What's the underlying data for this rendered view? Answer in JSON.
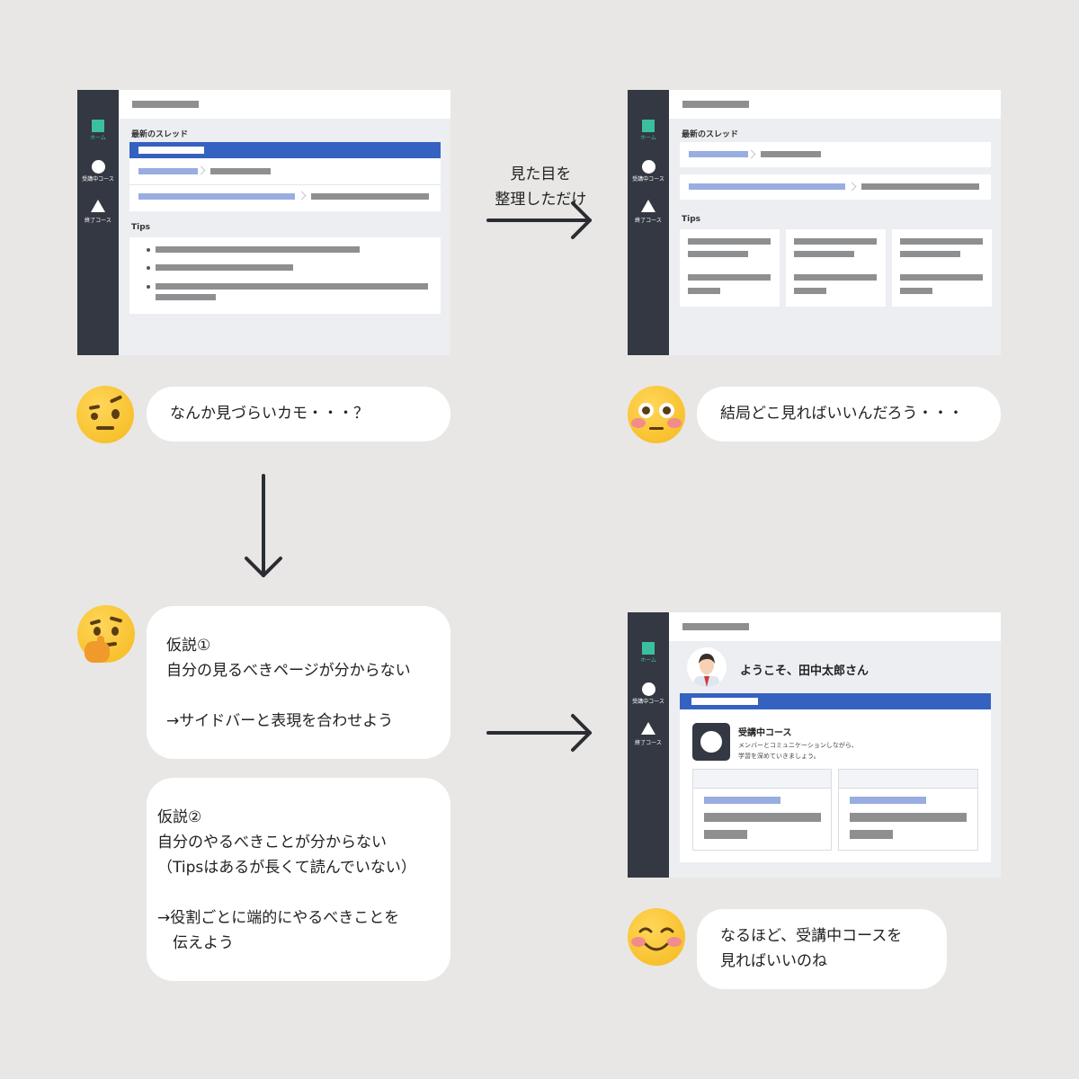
{
  "mock1": {
    "thread_label": "最新のスレッド",
    "tips_label": "Tips",
    "nav": {
      "home": "ホーム",
      "enrolled": "受講中コース",
      "finished": "終了コース"
    }
  },
  "mock2": {
    "thread_label": "最新のスレッド",
    "tips_label": "Tips",
    "nav": {
      "home": "ホーム",
      "enrolled": "受講中コース",
      "finished": "終了コース"
    }
  },
  "mock3": {
    "welcome": "ようこそ、田中太郎さん",
    "course_title": "受講中コース",
    "course_desc_1": "メンバーとコミュニケーションしながら、",
    "course_desc_2": "学習を深めていきましょう。",
    "nav": {
      "home": "ホーム",
      "enrolled": "受講中コース",
      "finished": "終了コース"
    }
  },
  "arrow_label": {
    "line1": "見た目を",
    "line2": "整理しただけ"
  },
  "bubbles": {
    "b1": "なんか見づらいカモ・・・？",
    "b2": "結局どこ見ればいいんだろう・・・",
    "b3": {
      "l1": "仮説①",
      "l2": "自分の見るべきページが分からない",
      "l3": "→サイドバーと表現を合わせよう"
    },
    "b4": {
      "l1": "仮説②",
      "l2": "自分のやるべきことが分からない",
      "l3": "（Tipsはあるが長くて読んでいない）",
      "l4": "→役割ごとに端的にやるべきことを",
      "l5": "　伝えよう"
    },
    "b5": {
      "l1": "なるほど、受講中コースを",
      "l2": "見ればいいのね"
    }
  },
  "emojis": [
    "raised-eyebrow-face-icon",
    "flushed-face-icon",
    "thinking-face-icon",
    "smiling-blushing-face-icon"
  ],
  "colors": {
    "sidebar": "#333842",
    "accent_green": "#3bbf9e",
    "accent_blue": "#3561c1",
    "link_blue": "#98ade0",
    "background": "#e8e7e5"
  }
}
